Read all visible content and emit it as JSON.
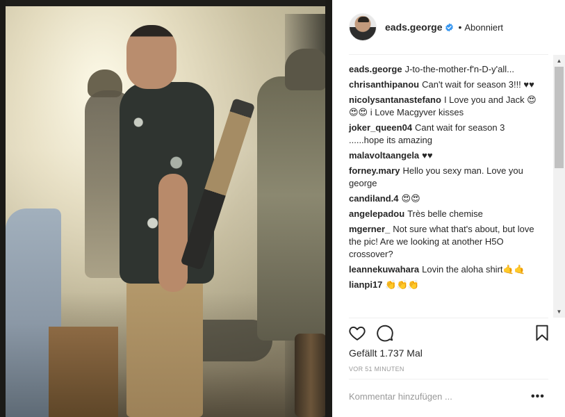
{
  "post": {
    "photo_alt_icon": "post-photo",
    "header": {
      "username": "eads.george",
      "verified_icon": "verified-badge-icon",
      "separator": "•",
      "follow_status": "Abonniert"
    },
    "comments": [
      {
        "user": "eads.george",
        "text": "J-to-the-mother-f'n-D-y'all..."
      },
      {
        "user": "chrisanthipanou",
        "text": "Can't wait for season 3!!! ♥♥"
      },
      {
        "user": "nicolysantanastefano",
        "text": "I Love you and Jack 😍😍😍 i Love Macgyver kisses"
      },
      {
        "user": "joker_queen04",
        "text": "Cant wait for season 3 ......hope its amazing"
      },
      {
        "user": "malavoltaangela",
        "text": "♥♥"
      },
      {
        "user": "forney.mary",
        "text": "Hello you sexy man. Love you george"
      },
      {
        "user": "candiland.4",
        "text": "😍😍"
      },
      {
        "user": "angelepadou",
        "text": "Très belle chemise"
      },
      {
        "user": "mgerner_",
        "text": "Not sure what that's about, but love the pic! Are we looking at another H5O crossover?"
      },
      {
        "user": "leannekuwahara",
        "text": "Lovin the aloha shirt🤙🤙"
      },
      {
        "user": "lianpi17",
        "text": "👏👏👏"
      }
    ],
    "actions": {
      "like_icon": "heart-icon",
      "comment_icon": "comment-bubble-icon",
      "save_icon": "bookmark-icon"
    },
    "likes_text": "Gefällt 1.737 Mal",
    "timestamp": "VOR 51 MINUTEN",
    "add_comment_placeholder": "Kommentar hinzufügen ...",
    "more_label": "•••"
  },
  "colors": {
    "text": "#262626",
    "muted": "#999999",
    "divider": "#efefef",
    "verified_blue": "#3897f0"
  }
}
